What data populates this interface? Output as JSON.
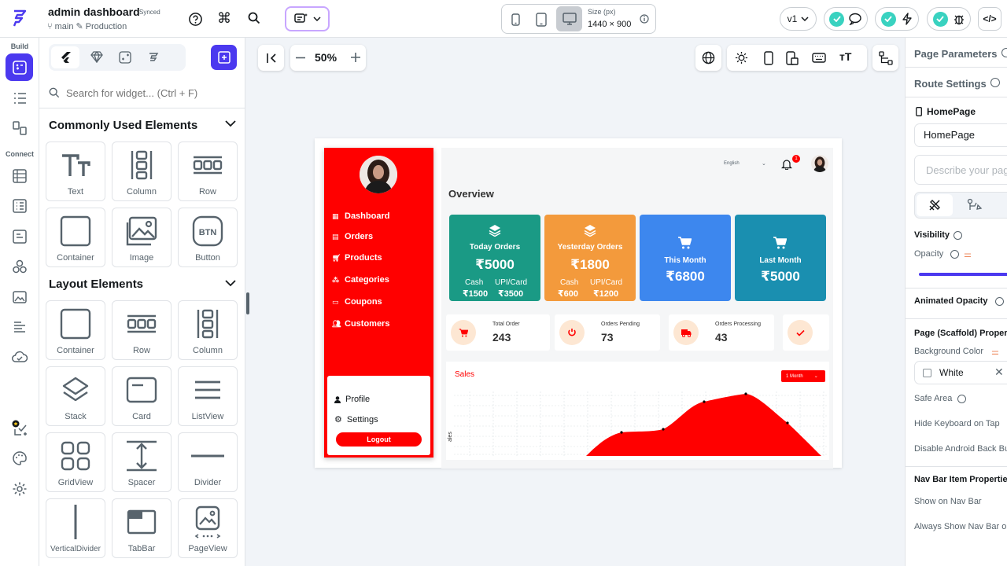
{
  "header": {
    "project_title": "admin dashboard",
    "sync_status": "Synced",
    "branch": "main",
    "environment": "Production",
    "size_label": "Size (px)",
    "size_value": "1440 × 900",
    "version": "v1",
    "accent": "#4b39ef"
  },
  "rail": {
    "build_label": "Build",
    "connect_label": "Connect"
  },
  "widgets": {
    "search_placeholder": "Search for widget... (Ctrl + F)",
    "common_title": "Commonly Used Elements",
    "common": [
      {
        "label": "Text",
        "icon": "text-icon"
      },
      {
        "label": "Column",
        "icon": "column-icon"
      },
      {
        "label": "Row",
        "icon": "row-icon"
      },
      {
        "label": "Container",
        "icon": "container-icon"
      },
      {
        "label": "Image",
        "icon": "image-icon"
      },
      {
        "label": "Button",
        "icon": "button-icon"
      }
    ],
    "layout_title": "Layout Elements",
    "layout": [
      {
        "label": "Container",
        "icon": "container-icon"
      },
      {
        "label": "Row",
        "icon": "row-icon"
      },
      {
        "label": "Column",
        "icon": "column-icon"
      },
      {
        "label": "Stack",
        "icon": "stack-icon"
      },
      {
        "label": "Card",
        "icon": "card-icon"
      },
      {
        "label": "ListView",
        "icon": "listview-icon"
      },
      {
        "label": "GridView",
        "icon": "gridview-icon"
      },
      {
        "label": "Spacer",
        "icon": "spacer-icon"
      },
      {
        "label": "Divider",
        "icon": "divider-icon"
      },
      {
        "label": "VerticalDivider",
        "icon": "vertical-divider-icon"
      },
      {
        "label": "TabBar",
        "icon": "tabbar-icon"
      },
      {
        "label": "PageView",
        "icon": "pageview-icon"
      }
    ]
  },
  "canvas": {
    "zoom": "50%"
  },
  "preview": {
    "brand_red": "#ff0000",
    "menu": [
      "Dashboard",
      "Orders",
      "Products",
      "Categories",
      "Coupons",
      "Customers"
    ],
    "profile_items": [
      "Profile",
      "Settings"
    ],
    "logout": "Logout",
    "language": "English",
    "notification_count": "1",
    "overview_title": "Overview",
    "cards": [
      {
        "title": "Today Orders",
        "value": "₹5000",
        "cash_label": "Cash",
        "cash": "₹1500",
        "card_label": "UPI/Card",
        "card": "₹3500",
        "color": "#1a9a85"
      },
      {
        "title": "Yesterday Orders",
        "value": "₹1800",
        "cash_label": "Cash",
        "cash": "₹600",
        "card_label": "UPI/Card",
        "card": "₹1200",
        "color": "#f39a3c"
      },
      {
        "title": "This Month",
        "value": "₹6800",
        "color": "#3d87ee"
      },
      {
        "title": "Last Month",
        "value": "₹5000",
        "color": "#1a8fb0"
      }
    ],
    "stats": [
      {
        "label": "Total Order",
        "value": "243"
      },
      {
        "label": "Orders Pending",
        "value": "73"
      },
      {
        "label": "Orders Processing",
        "value": "43"
      }
    ],
    "sales_title": "Sales",
    "sales_filter": "1 Month",
    "sales_axis": "ales"
  },
  "right_panel": {
    "page_parameters": "Page Parameters",
    "route_settings": "Route Settings",
    "page_heading": "HomePage",
    "page_name_value": "HomePage",
    "describe_placeholder": "Describe your page",
    "visibility": "Visibility",
    "opacity": "Opacity",
    "animated_opacity": "Animated Opacity",
    "scaffold_props": "Page (Scaffold) Properties",
    "background_color_label": "Background Color",
    "background_color_value": "White",
    "safe_area": "Safe Area",
    "hide_keyboard": "Hide Keyboard on Tap",
    "disable_android_back": "Disable Android Back Button",
    "nav_bar_props": "Nav Bar Item Properties",
    "show_on_nav": "Show on Nav Bar",
    "always_show_nav": "Always Show Nav Bar on"
  }
}
